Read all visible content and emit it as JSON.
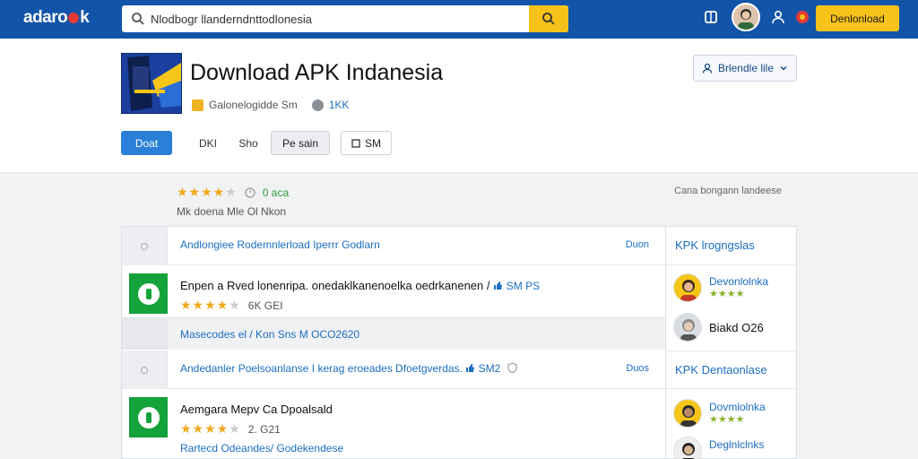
{
  "topbar": {
    "logo": "adaro",
    "logo_suffix": "k",
    "search_value": "Nlodbogr llanderndnttodlonesia",
    "cta_label": "Denlonload"
  },
  "app": {
    "title": "Download APK Indanesia",
    "developer": "Galonelogidde Sm",
    "size": "1KK",
    "dropdown_label": "Brlendle lile",
    "actions": {
      "primary": "Doat",
      "second": "DKI",
      "third": "Sho",
      "fourth": "Pe sain",
      "fifth": "SM"
    }
  },
  "rating": {
    "stars_text": "★★★★",
    "stars_off": "★",
    "count": "0 aca",
    "sub": "Mk doena Mle Ol Nkon",
    "right_note": "Cana bongann landeese"
  },
  "list": {
    "section1": {
      "heading": "Andlongiee Rodemnlerload Iperrr Godlarn",
      "right": "Duon"
    },
    "item1": {
      "title": "Enpen a Rved lonenripa. onedaklkanenoelka oedrkanenen /",
      "title_tag": "SM PS",
      "stars": "★★★★",
      "stars_off": "★",
      "meta": "6K GEI",
      "footer": "Masecodes el / Kon Sns M OCO2620"
    },
    "section2": {
      "heading": "Andedanler Poelsoanlanse I kerag eroeades Dfoetgverdas.",
      "heading_tag": "SM2",
      "right": "Duos"
    },
    "item2": {
      "title": "Aemgara Mepv Ca Dpoalsald",
      "stars": "★★★★",
      "stars_off": "★",
      "meta": "2. G21",
      "footer": "Rartecd Odeandes/ Godekendese"
    }
  },
  "side": {
    "head1": "KPK lrogngslas",
    "user1_name": "Devonlolnka",
    "user1_sub": "★★★★",
    "user2_name": "Biakd O26",
    "head2": "KPK Dentaonlase",
    "user3_name": "Dovmlolnka",
    "user3_sub": "★★★★",
    "user4_name": "Deglnlclnks"
  },
  "colors": {
    "topbar": "#1254a8",
    "accent_yellow": "#f7c21a",
    "link_blue": "#1b6ec2",
    "app_green": "#14a23a"
  }
}
